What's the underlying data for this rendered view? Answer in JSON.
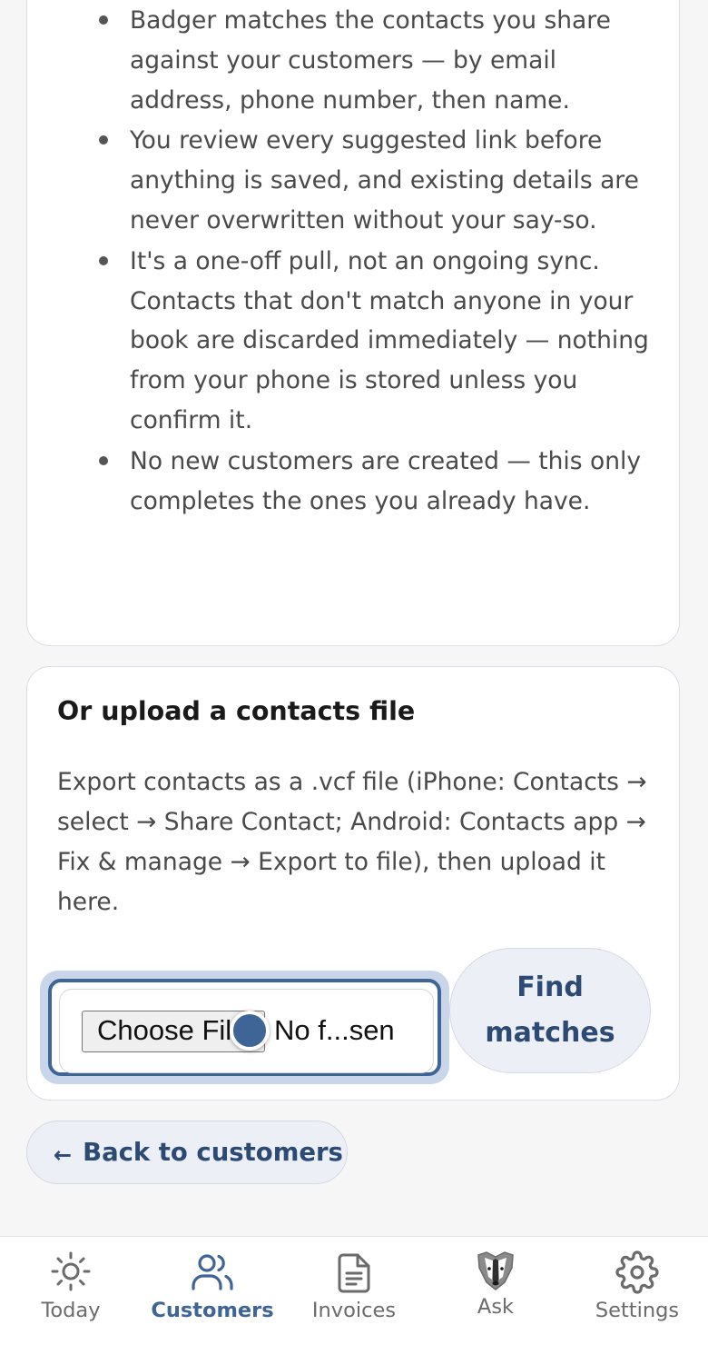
{
  "info_card": {
    "items": [
      "Badger matches the contacts you share against your customers — by email address, phone number, then name.",
      "You review every suggested link before anything is saved, and existing details are never overwritten without your say-so.",
      "It's a one-off pull, not an ongoing sync. Contacts that don't match anyone in your book are discarded immediately — nothing from your phone is stored unless you confirm it.",
      "No new customers are created — this only completes the ones you already have."
    ]
  },
  "upload_card": {
    "title": "Or upload a contacts file",
    "description": "Export contacts as a .vcf file (iPhone: Contacts → select → Share Contact; Android: Contacts app → Fix & manage → Export to file), then upload it here.",
    "choose_file_label": "Choose File",
    "file_status": "No f...sen",
    "find_matches_label": "Find matches"
  },
  "back_button": {
    "arrow": "←",
    "label": "Back to customers"
  },
  "bottom_nav": {
    "items": [
      {
        "label": "Today",
        "icon": "sun-icon",
        "active": false
      },
      {
        "label": "Customers",
        "icon": "users-icon",
        "active": true
      },
      {
        "label": "Invoices",
        "icon": "document-icon",
        "active": false
      },
      {
        "label": "Ask",
        "icon": "badger-icon",
        "active": false
      },
      {
        "label": "Settings",
        "icon": "gear-icon",
        "active": false
      }
    ]
  },
  "colors": {
    "accent": "#3f6496",
    "button_bg": "#eceff6",
    "button_text": "#2c4a74"
  }
}
